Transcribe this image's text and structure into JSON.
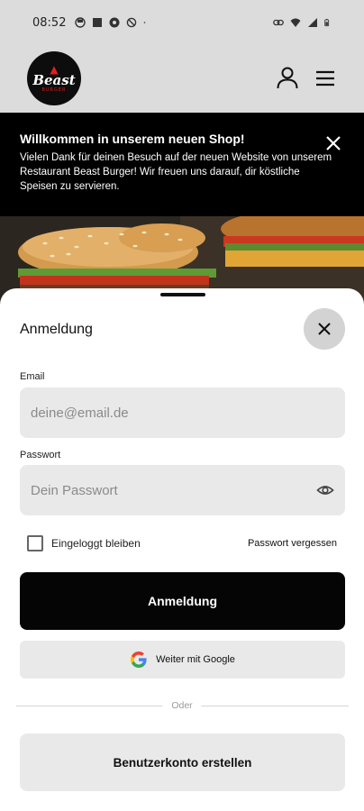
{
  "status_bar": {
    "time": "08:52"
  },
  "header": {
    "logo_text": "Beast",
    "logo_sub": "BURGER"
  },
  "banner": {
    "title": "Willkommen in unserem neuen Shop!",
    "text": "Vielen Dank für deinen Besuch auf der neuen Website von unserem Restaurant Beast Burger! Wir freuen uns darauf, dir köstliche Speisen zu servieren."
  },
  "login": {
    "title": "Anmeldung",
    "email_label": "Email",
    "email_placeholder": "deine@email.de",
    "email_value": "",
    "password_label": "Passwort",
    "password_placeholder": "Dein Passwort",
    "password_value": "",
    "remember_label": "Eingeloggt bleiben",
    "remember_checked": false,
    "forgot_label": "Passwort vergessen",
    "submit_label": "Anmeldung",
    "google_label": "Weiter mit Google",
    "divider_label": "Oder",
    "register_label": "Benutzerkonto erstellen"
  },
  "colors": {
    "header_bg": "#dcdcdc",
    "banner_bg": "#000000",
    "primary_button": "#050505",
    "field_bg": "#e9e9e9",
    "logo_accent": "#e11d1d"
  },
  "icons": {
    "user": "user-icon",
    "menu": "hamburger-menu-icon",
    "close": "close-icon",
    "eye": "eye-icon",
    "google": "google-icon"
  }
}
